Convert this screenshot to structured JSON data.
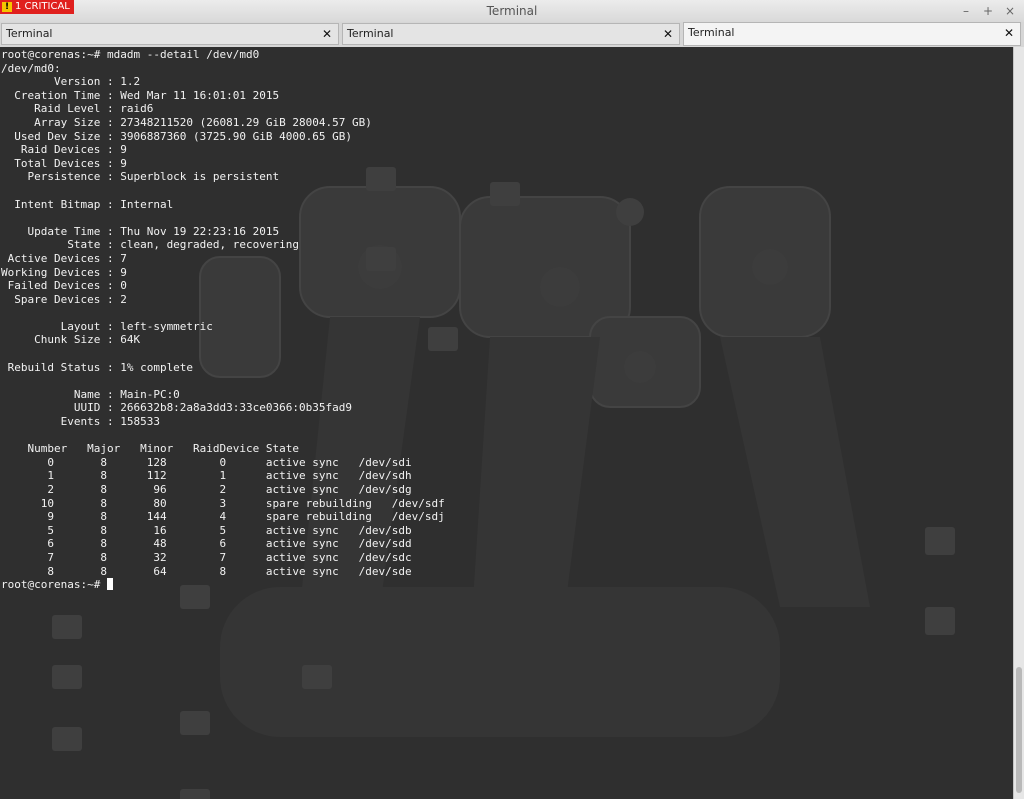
{
  "notification": {
    "label": "1 CRITICAL",
    "icon": "warning-icon"
  },
  "window": {
    "title": "Terminal",
    "controls": {
      "minimize": "–",
      "maximize": "+",
      "close": "×"
    }
  },
  "tabs": [
    {
      "label": "Terminal",
      "close": "✕"
    },
    {
      "label": "Terminal",
      "close": "✕"
    },
    {
      "label": "Terminal",
      "close": "✕",
      "active": true
    }
  ],
  "terminal": {
    "lines": [
      "root@corenas:~# mdadm --detail /dev/md0",
      "/dev/md0:",
      "        Version : 1.2",
      "  Creation Time : Wed Mar 11 16:01:01 2015",
      "     Raid Level : raid6",
      "     Array Size : 27348211520 (26081.29 GiB 28004.57 GB)",
      "  Used Dev Size : 3906887360 (3725.90 GiB 4000.65 GB)",
      "   Raid Devices : 9",
      "  Total Devices : 9",
      "    Persistence : Superblock is persistent",
      "",
      "  Intent Bitmap : Internal",
      "",
      "    Update Time : Thu Nov 19 22:23:16 2015",
      "          State : clean, degraded, recovering",
      " Active Devices : 7",
      "Working Devices : 9",
      " Failed Devices : 0",
      "  Spare Devices : 2",
      "",
      "         Layout : left-symmetric",
      "     Chunk Size : 64K",
      "",
      " Rebuild Status : 1% complete",
      "",
      "           Name : Main-PC:0",
      "           UUID : 266632b8:2a8a3dd3:33ce0366:0b35fad9",
      "         Events : 158533",
      "",
      "    Number   Major   Minor   RaidDevice State",
      "       0       8      128        0      active sync   /dev/sdi",
      "       1       8      112        1      active sync   /dev/sdh",
      "       2       8       96        2      active sync   /dev/sdg",
      "      10       8       80        3      spare rebuilding   /dev/sdf",
      "       9       8      144        4      spare rebuilding   /dev/sdj",
      "       5       8       16        5      active sync   /dev/sdb",
      "       6       8       48        6      active sync   /dev/sdd",
      "       7       8       32        7      active sync   /dev/sdc",
      "       8       8       64        8      active sync   /dev/sde"
    ],
    "prompt": "root@corenas:~# "
  }
}
